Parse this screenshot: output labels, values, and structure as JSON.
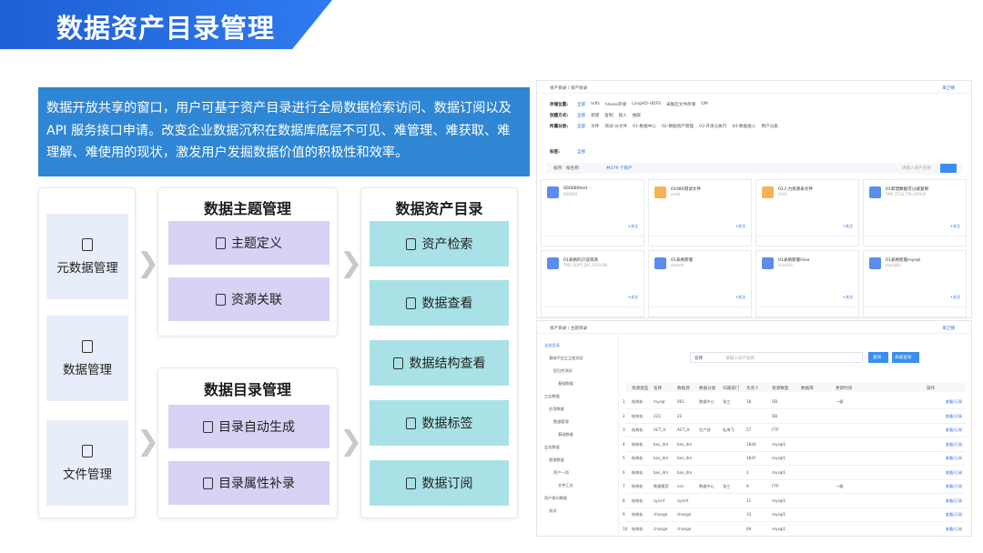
{
  "page": {
    "title": "数据资产目录管理",
    "intro": "数据开放共享的窗口，用户可基于资产目录进行全局数据检索访问、数据订阅以及API 服务接口申请。改变企业数据沉积在数据库底层不可见、难管理、难获取、难理解、难使用的现状，激发用户发掘数据价值的积极性和效率。"
  },
  "col1": {
    "items": [
      {
        "label": "元数据管理",
        "icon": "document-icon"
      },
      {
        "label": "数据管理",
        "icon": "list-icon"
      },
      {
        "label": "文件管理",
        "icon": "file-icon"
      }
    ]
  },
  "col2a": {
    "title": "数据主题管理",
    "items": [
      {
        "label": "主题定义",
        "icon": "edit-doc-icon"
      },
      {
        "label": "资源关联",
        "icon": "link-doc-icon"
      }
    ]
  },
  "col2b": {
    "title": "数据目录管理",
    "items": [
      {
        "label": "目录自动生成",
        "icon": "list-icon"
      },
      {
        "label": "目录属性补录",
        "icon": "edit-doc-icon"
      }
    ]
  },
  "col3": {
    "title": "数据资产目录",
    "items": [
      {
        "label": "资产检索",
        "icon": "search-list-icon"
      },
      {
        "label": "数据查看",
        "icon": "document-icon"
      },
      {
        "label": "数据结构查看",
        "icon": "structure-icon"
      },
      {
        "label": "数据标签",
        "icon": "tag-icon"
      },
      {
        "label": "数据订阅",
        "icon": "subscribe-icon"
      }
    ]
  },
  "shot1": {
    "breadcrumb": "资产目录 / 资产目录",
    "user": "单卫锦",
    "rows": [
      {
        "label": "存储位置:",
        "opts": [
          "全部",
          "hdfs",
          "hbase存储",
          "LzogHD-HDFS",
          "采集区文件存储",
          "OM"
        ]
      },
      {
        "label": "创建方式:",
        "opts": [
          "全部",
          "新建",
          "复制",
          "接入",
          "抽取"
        ]
      },
      {
        "label": "所属分类:",
        "opts": [
          "全部",
          "文件",
          "测试-分文件",
          "01-数据中心",
          "02-数据资产管理",
          "03-开发与执行",
          "04-数据接入",
          "用户分类"
        ]
      },
      {
        "label": "标签:",
        "opts": [
          "全部"
        ]
      }
    ],
    "sort_label": "排序:",
    "sort_value": "按名称",
    "total": "共379 个资产",
    "search_placeholder": "请输入资产名称",
    "cards": [
      {
        "name": "000080test",
        "sub": "000080",
        "tile": "#5b8def"
      },
      {
        "name": "01080测试文件",
        "sub": "ceshi",
        "tile": "#f5b453"
      },
      {
        "name": "01人力资源表文件",
        "sub": "0101",
        "tile": "#f5b453"
      },
      {
        "name": "01新建数据可以被复制",
        "sub": "TMP_RT14_TM_GROUP",
        "tile": "#5b8def"
      },
      {
        "name": "01表格的只读资源",
        "sub": "TMP_SOPT_DIC_REGION",
        "tile": "#5b8def"
      },
      {
        "name": "01表格新版",
        "sub": "xzsbdd",
        "tile": "#5b8def"
      },
      {
        "name": "01表格新版Hive",
        "sub": "hive001",
        "tile": "#5b8def"
      },
      {
        "name": "01表格新版mysql",
        "sub": "mysql01",
        "tile": "#5b8def"
      }
    ],
    "card_more": "+关注"
  },
  "shot2": {
    "breadcrumb": "资产目录 / 主题目录",
    "user": "单卫锦",
    "tree": [
      "全部目录",
      "基础平台工工程测试",
      "回归性测试",
      "基础数据",
      "工业数据",
      "应用数据",
      "数据管理",
      "基础数据",
      "业务数据",
      "管理数据",
      "资产一项",
      "文件汇总",
      "资产接口数据",
      "测试"
    ],
    "search_select": "名称",
    "search_placeholder": "请输入资产名称",
    "search_btn": "查询",
    "reset_btn": "高级查询",
    "table_head": [
      "资源类型",
      "名称",
      "数据源",
      "数据分类",
      "归属部门",
      "负责人",
      "资源数量",
      "数据库",
      "更新时间",
      "操作"
    ],
    "rows": [
      [
        "结构化",
        "mysql",
        "001",
        "数据中心",
        "张三",
        "18",
        "DB",
        "一级",
        "查看/订阅"
      ],
      [
        "结构化",
        "222",
        "22",
        "",
        "",
        "",
        "DB",
        "",
        "查看/订阅"
      ],
      [
        "结构化",
        "ACT_H",
        "ACT_H",
        "生产部",
        "杜海飞",
        "27",
        "FTP",
        "",
        "查看/订阅"
      ],
      [
        "结构化",
        "bas_dm",
        "bas_dm",
        "",
        "",
        "1844",
        "mysql1",
        "",
        "查看/订阅"
      ],
      [
        "结构化",
        "bas_dm",
        "bas_dm",
        "",
        "",
        "1847",
        "mysql1",
        "",
        "查看/订阅"
      ],
      [
        "结构化",
        "bas_dm",
        "bas_dm",
        "",
        "",
        "2",
        "mysql1",
        "",
        "查看/订阅"
      ],
      [
        "结构化",
        "数据模型",
        "ces",
        "数据中心",
        "张三",
        "9",
        "FTP",
        "一级",
        "查看/订阅"
      ],
      [
        "结构化",
        "sysinf",
        "sysinf",
        "",
        "",
        "11",
        "mysql1",
        "",
        "查看/订阅"
      ],
      [
        "结构化",
        "change",
        "change",
        "",
        "",
        "33",
        "mysql1",
        "",
        "查看/订阅"
      ],
      [
        "结构化",
        "change",
        "change",
        "",
        "",
        "69",
        "mysql1",
        "",
        "查看/订阅"
      ]
    ]
  }
}
